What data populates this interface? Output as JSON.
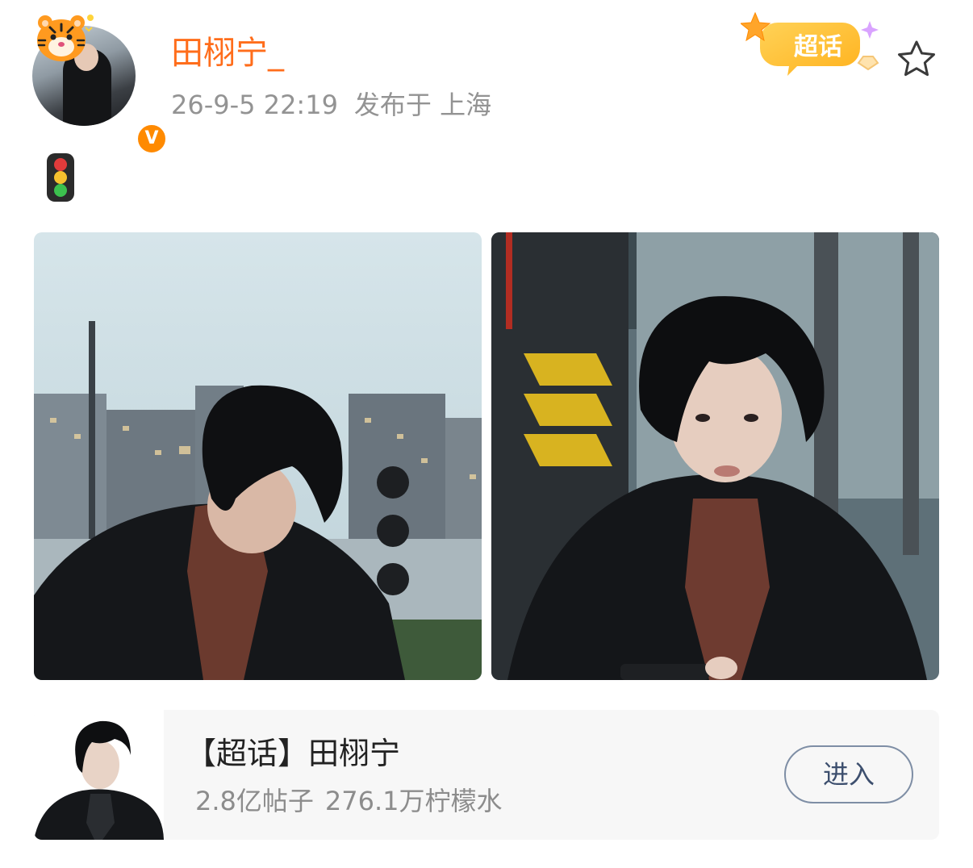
{
  "post": {
    "author": {
      "name": "田栩宁_",
      "verified_badge": "V",
      "accent_color": "#ff6d1b",
      "badge_color": "#ff8a00"
    },
    "time": "26-9-5 22:19",
    "location": "发布于 上海",
    "supertopic_badge_label": "超话",
    "star_icon": "star-outline-icon",
    "body_emoji": "traffic-light-icon",
    "images": [
      {
        "name": "photo-1"
      },
      {
        "name": "photo-2"
      }
    ]
  },
  "supertopic_card": {
    "title": "【超话】田栩宁",
    "posts": "2.8亿帖子",
    "fans": "276.1万柠檬水",
    "enter_label": "进入",
    "button_color": "#7e8ea5"
  }
}
